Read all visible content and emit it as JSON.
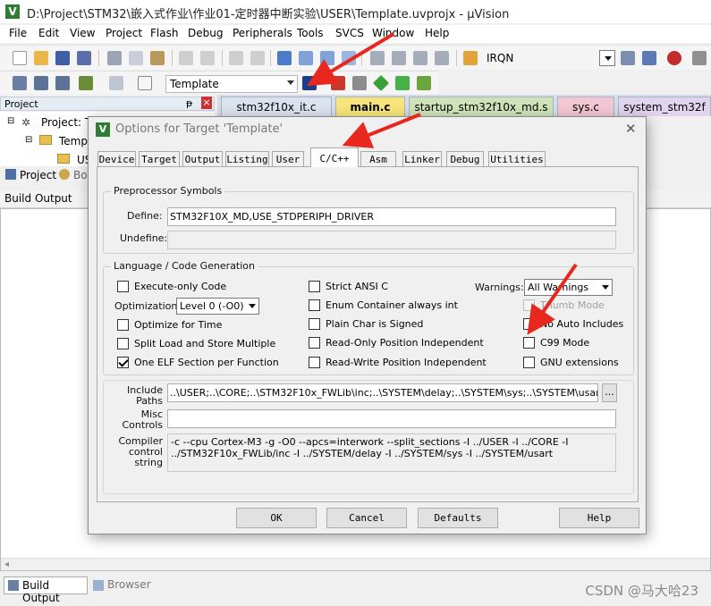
{
  "window": {
    "title": "D:\\Project\\STM32\\嵌入式作业\\作业01-定时器中断实验\\USER\\Template.uvprojx - µVision",
    "app_icon": "V"
  },
  "menu": [
    "File",
    "Edit",
    "View",
    "Project",
    "Flash",
    "Debug",
    "Peripherals",
    "Tools",
    "SVCS",
    "Window",
    "Help"
  ],
  "toolbar": {
    "irqn": "IRQN",
    "target": "Template"
  },
  "project_pane": {
    "title": "Project",
    "pin": "ᵽ",
    "close": "×",
    "tree": [
      "Project: Te",
      "Templ",
      "US"
    ],
    "tabs": [
      "Project",
      "Bo"
    ]
  },
  "file_tabs": [
    {
      "label": "stm32f10x_it.c",
      "color": "#dbe3ee"
    },
    {
      "label": "main.c",
      "color": "#f7e57b"
    },
    {
      "label": "startup_stm32f10x_md.s",
      "color": "#cfe3b9"
    },
    {
      "label": "sys.c",
      "color": "#f2c6d3"
    },
    {
      "label": "system_stm32f",
      "color": "#e2d3ef"
    }
  ],
  "build_output": {
    "title": "Build Output"
  },
  "bottom_tabs": [
    "Build Output",
    "Browser"
  ],
  "watermark": "CSDN @马大哈23",
  "dialog": {
    "title": "Options for Target 'Template'",
    "close": "✕",
    "tabs": [
      "Device",
      "Target",
      "Output",
      "Listing",
      "User",
      "C/C++",
      "Asm",
      "Linker",
      "Debug",
      "Utilities"
    ],
    "preprocessor": {
      "group": "Preprocessor Symbols",
      "define_label": "Define:",
      "define_value": "STM32F10X_MD,USE_STDPERIPH_DRIVER",
      "undefine_label": "Undefine:",
      "undefine_value": ""
    },
    "language": {
      "group": "Language / Code Generation",
      "execute_only": "Execute-only Code",
      "optimization_label": "Optimization:",
      "optimization_value": "Level 0 (-O0)",
      "optimize_time": "Optimize for Time",
      "split_load": "Split Load and Store Multiple",
      "one_elf": "One ELF Section per Function",
      "strict_ansi": "Strict ANSI C",
      "enum_container": "Enum Container always int",
      "plain_char": "Plain Char is Signed",
      "ro_pi": "Read-Only Position Independent",
      "rw_pi": "Read-Write Position Independent",
      "warnings_label": "Warnings:",
      "warnings_value": "All Warnings",
      "thumb_mode": "Thumb Mode",
      "no_auto": "No Auto Includes",
      "c99": "C99 Mode",
      "gnu_ext": "GNU extensions"
    },
    "include_paths_label": "Include\nPaths",
    "include_paths_value": "..\\USER;..\\CORE;..\\STM32F10x_FWLib\\inc;..\\SYSTEM\\delay;..\\SYSTEM\\sys;..\\SYSTEM\\usart",
    "browse": "...",
    "misc_label": "Misc\nControls",
    "misc_value": "",
    "compiler_label": "Compiler\ncontrol\nstring",
    "compiler_value": "-c --cpu Cortex-M3 -g -O0 --apcs=interwork --split_sections -I ../USER -I ../CORE -I ../STM32F10x_FWLib/inc -I ../SYSTEM/delay -I ../SYSTEM/sys -I ../SYSTEM/usart",
    "buttons": {
      "ok": "OK",
      "cancel": "Cancel",
      "defaults": "Defaults",
      "help": "Help"
    }
  },
  "colors": {
    "annotation_arrow": "#e8281e",
    "tab_bar": "#d5dde8"
  }
}
